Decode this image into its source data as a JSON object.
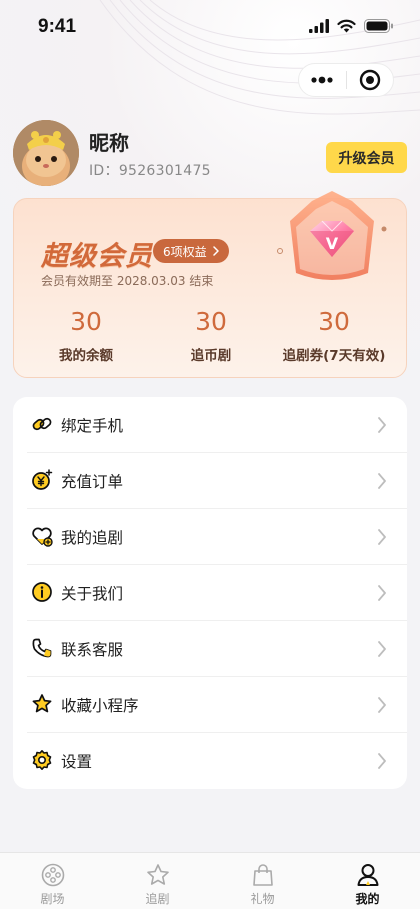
{
  "status_bar": {
    "time": "9:41"
  },
  "profile": {
    "nickname": "昵称",
    "id_label": "ID：",
    "id_value": "9526301475",
    "upgrade_label": "升级会员"
  },
  "vip": {
    "title": "超级会员",
    "rights_label": "6项权益",
    "expire_text": "会员有效期至 2028.03.03 结束",
    "stats": [
      {
        "value": "30",
        "label": "我的余额"
      },
      {
        "value": "30",
        "label": "追币剧"
      },
      {
        "value": "30",
        "label": "追剧券(7天有效)"
      }
    ],
    "accent": "#cf6a3c"
  },
  "menu": [
    {
      "label": "绑定手机",
      "icon": "link-icon"
    },
    {
      "label": "充值订单",
      "icon": "yen-coin-icon"
    },
    {
      "label": "我的追剧",
      "icon": "heart-plus-icon"
    },
    {
      "label": "关于我们",
      "icon": "info-icon"
    },
    {
      "label": "联系客服",
      "icon": "phone-icon"
    },
    {
      "label": "收藏小程序",
      "icon": "star-icon"
    },
    {
      "label": "设置",
      "icon": "gear-icon"
    }
  ],
  "tabbar": [
    {
      "label": "剧场",
      "icon": "film-reel-icon",
      "active": false
    },
    {
      "label": "追剧",
      "icon": "star-tab-icon",
      "active": false
    },
    {
      "label": "礼物",
      "icon": "gift-bag-icon",
      "active": false
    },
    {
      "label": "我的",
      "icon": "person-icon",
      "active": true
    }
  ],
  "colors": {
    "brand_yellow": "#ffd84a",
    "icon_yellow": "#ffcc22"
  }
}
